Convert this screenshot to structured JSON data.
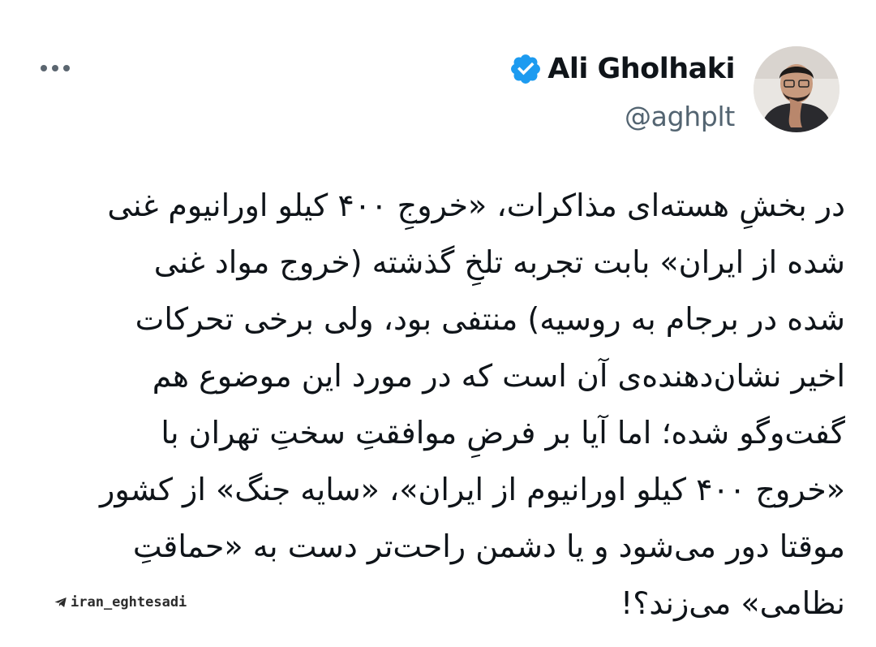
{
  "author": {
    "display_name": "Ali Gholhaki",
    "handle": "@aghplt",
    "verified": true,
    "avatar_icon": "profile-photo"
  },
  "tweet": {
    "lines": [
      "در بخشِ هسته‌ای مذاکرات، «خروجِ ۴۰۰ کیلو اورانیوم غنی",
      "شده از ایران» بابت تجربه تلخِ گذشته (خروج مواد غنی",
      "شده در برجام به روسیه) منتفی بود، ولی برخی تحرکات",
      "اخیر نشان‌دهنده‌ی آن است که در مورد این موضوع هم",
      "گفت‌وگو شده؛ اما آیا بر فرضِ موافقتِ سختِ تهران با",
      "«خروج ۴۰۰ کیلو اورانیوم از ایران»، «سایه جنگ» از کشور",
      "موقتا دور می‌شود و یا دشمن راحت‌تر دست به «حماقتِ",
      "نظامی» می‌زند؟!"
    ]
  },
  "watermark": {
    "text": "iran_eghtesadi",
    "icon": "telegram-icon"
  },
  "icons": {
    "more": "more-icon",
    "verified": "verified-badge-icon"
  },
  "colors": {
    "verified_blue": "#1d9bf0",
    "text_primary": "#0f1419",
    "text_secondary": "#536471"
  }
}
